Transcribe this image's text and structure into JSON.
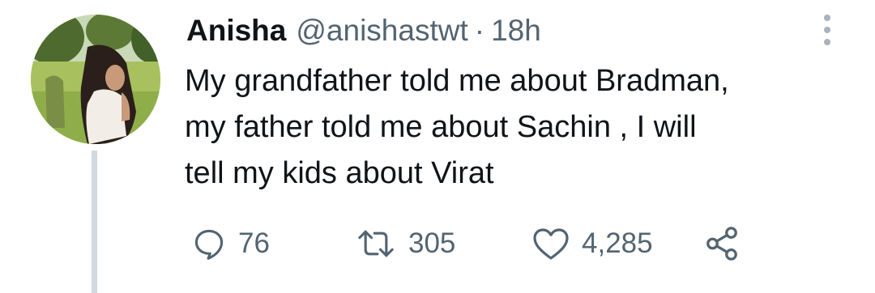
{
  "tweet": {
    "author_name": "Anisha",
    "handle": "@anishastwt",
    "separator": "·",
    "time": "18h",
    "text": "My grandfather told me about Bradman,\nmy father told me about Sachin , I will\ntell my kids about Virat"
  },
  "actions": {
    "reply_count": "76",
    "retweet_count": "305",
    "like_count": "4,285"
  },
  "icons": {
    "more": "more-vertical-icon",
    "reply": "reply-icon",
    "retweet": "retweet-icon",
    "like": "heart-icon",
    "share": "share-icon"
  },
  "colors": {
    "text_primary": "#0f1419",
    "text_secondary": "#536471",
    "thread_line": "#cfd9de"
  }
}
